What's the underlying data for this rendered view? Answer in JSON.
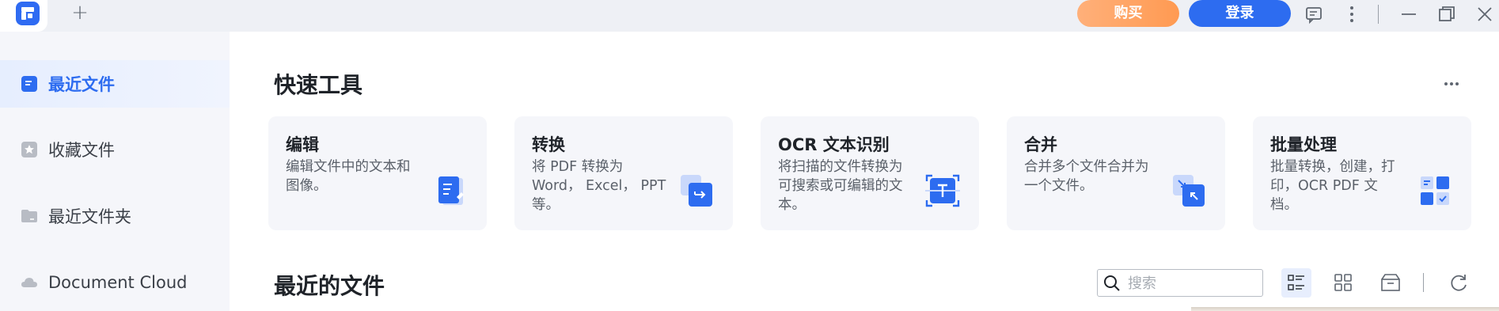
{
  "titlebar": {
    "new_tab_symbol": "+",
    "buy_label": "购买",
    "login_label": "登录",
    "icons": [
      "feedback-icon",
      "more-vertical-icon",
      "minimize-icon",
      "restore-icon",
      "close-icon"
    ]
  },
  "sidebar": {
    "items": [
      {
        "label": "最近文件",
        "icon": "recent-file-icon",
        "active": true
      },
      {
        "label": "收藏文件",
        "icon": "star-folder-icon",
        "active": false
      },
      {
        "label": "最近文件夹",
        "icon": "folder-icon",
        "active": false
      },
      {
        "label": "Document Cloud",
        "icon": "cloud-icon",
        "active": false
      }
    ]
  },
  "quick_tools": {
    "title": "快速工具",
    "more_icon": "more-horizontal-icon",
    "cards": [
      {
        "title": "编辑",
        "desc": "编辑文件中的文本和图像。",
        "icon": "edit-doc-icon"
      },
      {
        "title": "转换",
        "desc": "将 PDF 转换为 Word， Excel， PPT等。",
        "icon": "convert-icon"
      },
      {
        "title": "OCR 文本识别",
        "desc": "将扫描的文件转换为可搜索或可编辑的文本。",
        "icon": "ocr-icon"
      },
      {
        "title": "合并",
        "desc": "合并多个文件合并为一个文件。",
        "icon": "merge-icon"
      },
      {
        "title": "批量处理",
        "desc": "批量转换，创建，打印，OCR PDF 文档。",
        "icon": "batch-icon"
      }
    ]
  },
  "recent_files": {
    "title": "最近的文件",
    "search_placeholder": "搜索",
    "view_buttons": [
      "list-view-icon",
      "grid-view-icon",
      "archive-icon",
      "refresh-icon"
    ]
  },
  "colors": {
    "accent": "#2d6cf0",
    "buy": "#ff9a52",
    "sidebar_bg": "#f5f6fa"
  }
}
